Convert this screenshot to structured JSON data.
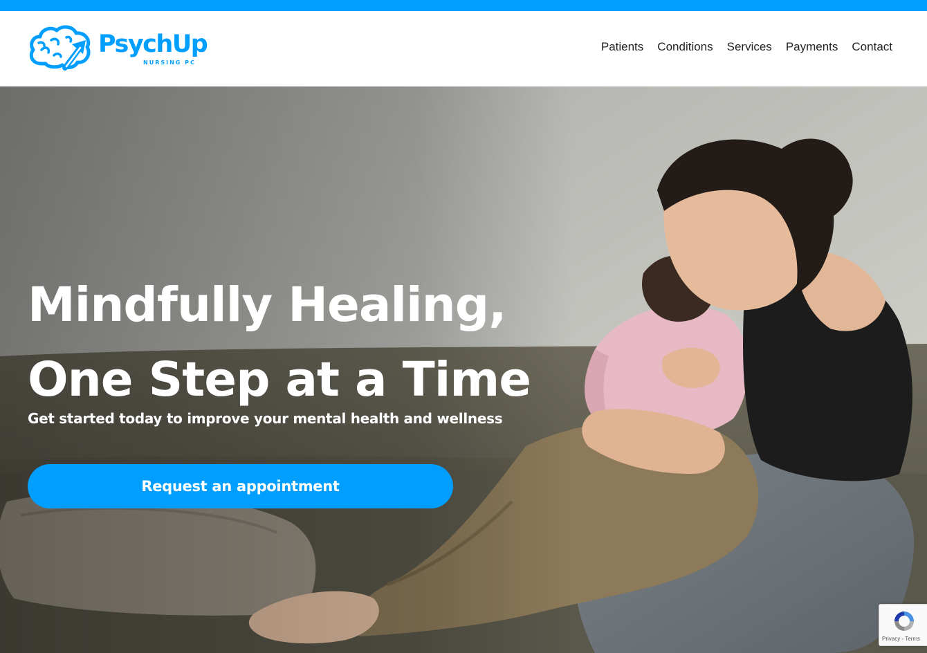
{
  "brand": {
    "name": "PsychUp",
    "tagline": "NURSING PC",
    "logo_icon": "brain-arrow-icon",
    "color": "#009fff"
  },
  "nav": {
    "items": [
      {
        "label": "Patients"
      },
      {
        "label": "Conditions"
      },
      {
        "label": "Services"
      },
      {
        "label": "Payments"
      },
      {
        "label": "Contact"
      }
    ]
  },
  "hero": {
    "title_line1": "Mindfully Healing,",
    "title_line2": "One Step at a Time",
    "subtitle": "Get started today to improve your mental health and wellness",
    "cta_label": "Request an appointment",
    "image_description_icon": "mother-daughter-hug-photo"
  },
  "recaptcha": {
    "icon": "recaptcha-icon",
    "privacy": "Privacy",
    "separator": " - ",
    "terms": "Terms"
  },
  "colors": {
    "accent": "#009fff",
    "nav_text": "#222222",
    "hero_text": "#ffffff"
  }
}
